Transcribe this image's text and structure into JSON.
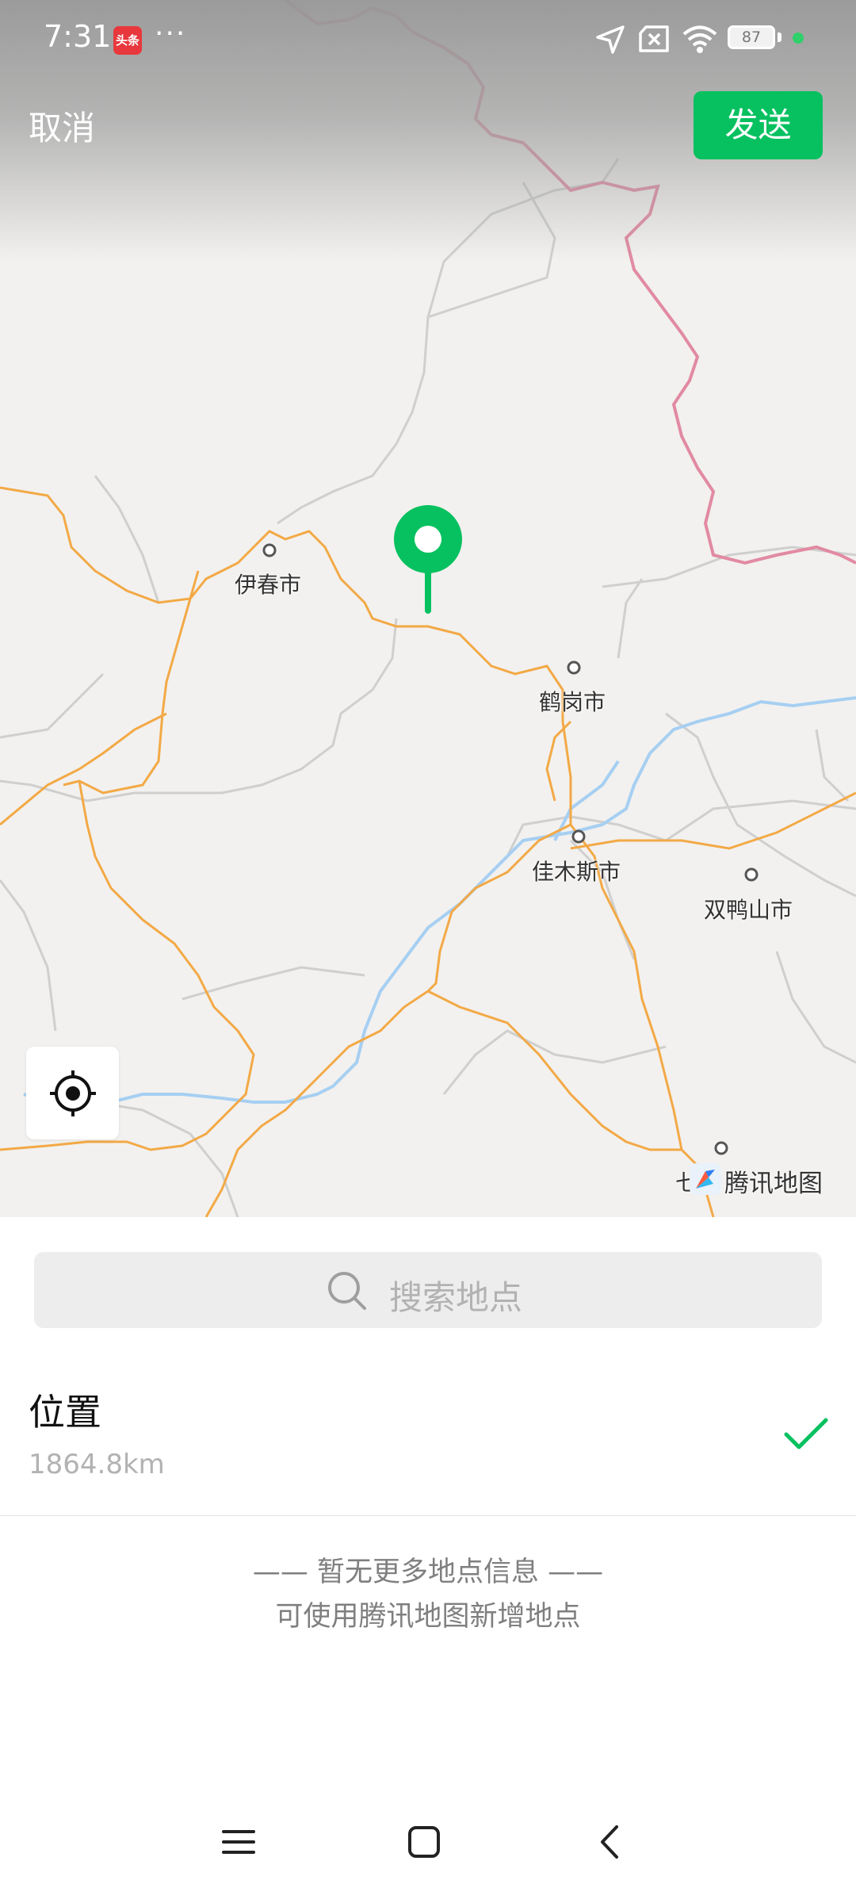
{
  "status_bar": {
    "time": "7:31",
    "app_icon_text": "头条",
    "more_dots": "···",
    "battery": "87",
    "icons": [
      "location-arrow-icon",
      "sim-off-icon",
      "wifi-icon",
      "battery-icon",
      "mic-indicator-icon"
    ]
  },
  "header": {
    "cancel_label": "取消",
    "send_label": "发送",
    "send_color": "#07c160"
  },
  "map": {
    "cities": [
      {
        "name": "伊春市"
      },
      {
        "name": "鹤岗市"
      },
      {
        "name": "佳木斯市"
      },
      {
        "name": "双鸭山市"
      },
      {
        "name": "七"
      }
    ],
    "logo_text": "腾讯地图",
    "controls": [
      "locate-icon",
      "location-pin-icon"
    ],
    "colors": {
      "land": "#f2f1ef",
      "highway": "#f3a946",
      "river": "#a6cff2",
      "border": "#e28aa3",
      "boundary": "#cfcfcf",
      "pin": "#07c160"
    }
  },
  "search": {
    "placeholder": "搜索地点"
  },
  "locations": [
    {
      "name": "位置",
      "distance": "1864.8km",
      "selected": true
    }
  ],
  "empty_hint": {
    "line1": "—— 暂无更多地点信息 ——",
    "line2": "可使用腾讯地图新增地点"
  },
  "nav_bar": {
    "buttons": [
      "menu-icon",
      "home-icon",
      "back-icon"
    ]
  }
}
